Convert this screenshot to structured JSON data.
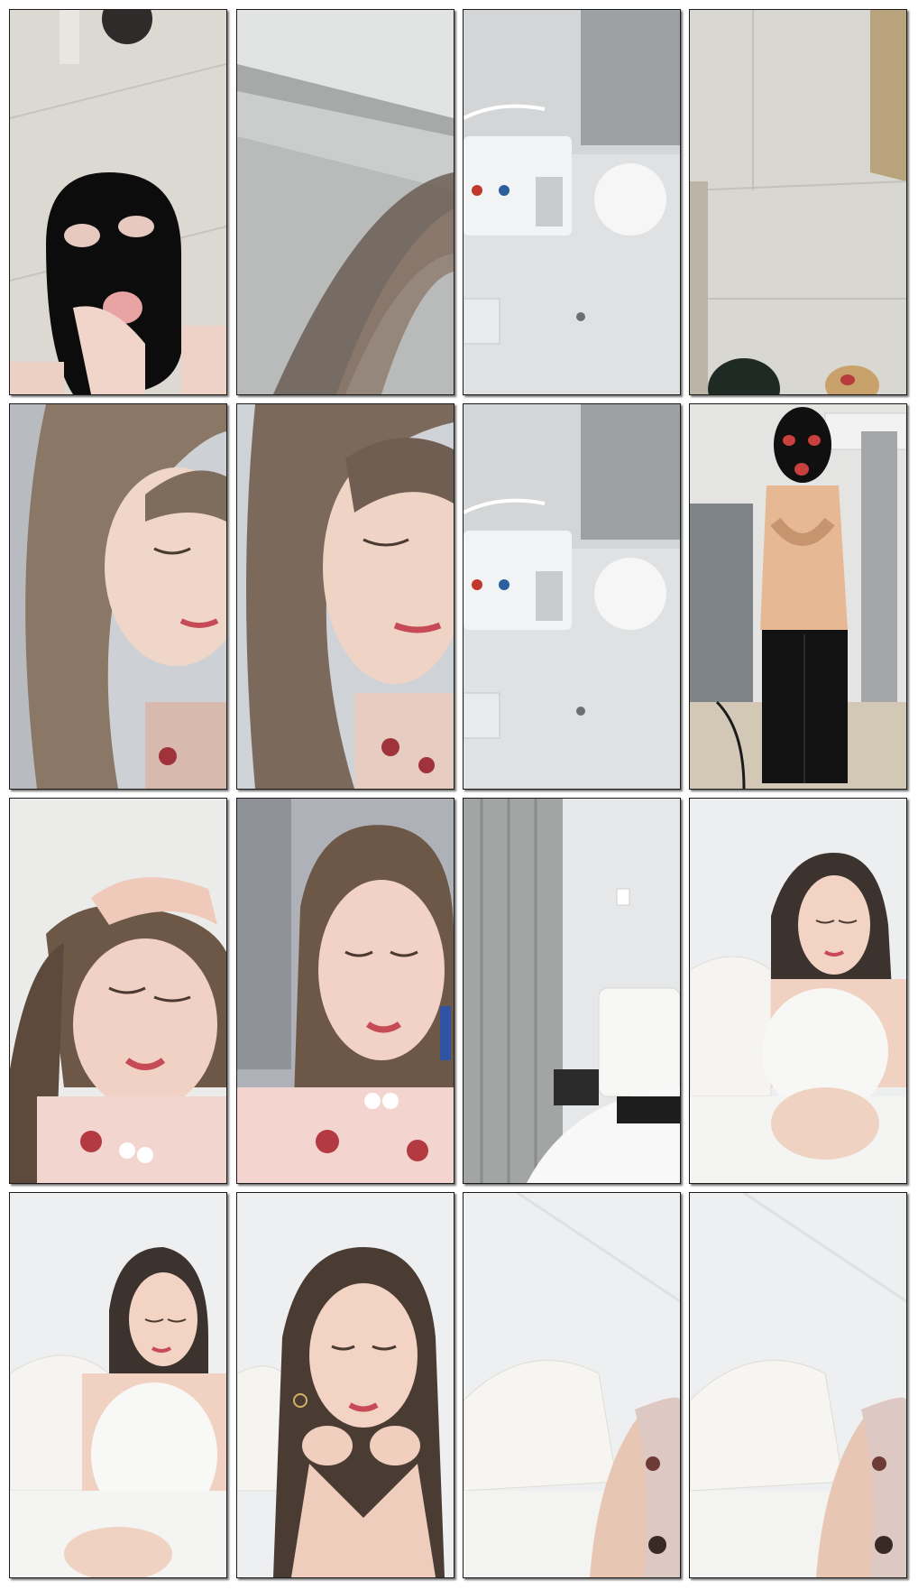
{
  "contact_sheet": {
    "frames": [
      {
        "subject": "black-mask-floor",
        "palette": [
          "#dfdcd6",
          "#0d0d0d",
          "#f0d5cc"
        ]
      },
      {
        "subject": "blurred-ceiling-hair",
        "palette": [
          "#cfd0d0",
          "#6b5e55",
          "#eceeee"
        ]
      },
      {
        "subject": "water-heater",
        "palette": [
          "#d0d2d3",
          "#8d9093",
          "#f3f5f6"
        ]
      },
      {
        "subject": "empty-floor-corner",
        "palette": [
          "#dad8d3",
          "#2a2a2a",
          "#b8a990"
        ]
      },
      {
        "subject": "woman-eyes-closed",
        "palette": [
          "#cfd3d8",
          "#8c7a6a",
          "#f1d9cc"
        ]
      },
      {
        "subject": "woman-eyes-closed-close",
        "palette": [
          "#d2d4d8",
          "#7c6a5c",
          "#f0d6c8"
        ]
      },
      {
        "subject": "water-heater",
        "palette": [
          "#d0d2d3",
          "#8d9093",
          "#f3f5f6"
        ]
      },
      {
        "subject": "masked-man-standing",
        "palette": [
          "#d8d8d6",
          "#111111",
          "#e7b894"
        ]
      },
      {
        "subject": "woman-hand-on-head",
        "palette": [
          "#ebeceb",
          "#6d5848",
          "#f3d2c7"
        ]
      },
      {
        "subject": "woman-looking-camera",
        "palette": [
          "#a9adb3",
          "#6d5848",
          "#f1d0c5"
        ]
      },
      {
        "subject": "bedroom-curtain",
        "palette": [
          "#e5e6e7",
          "#9a9c9c",
          "#f6f6f6"
        ]
      },
      {
        "subject": "woman-sitting-bed",
        "palette": [
          "#eceeef",
          "#3c332e",
          "#f0d2c2"
        ]
      },
      {
        "subject": "woman-sitting-bed-2",
        "palette": [
          "#eeeff0",
          "#3c332e",
          "#f0d2c2"
        ]
      },
      {
        "subject": "woman-chin-on-hands",
        "palette": [
          "#eeeff0",
          "#4b3c33",
          "#f0d2c2"
        ]
      },
      {
        "subject": "bed-headboard-arm",
        "palette": [
          "#eeeff0",
          "#d8d0c8",
          "#e8c6b4"
        ]
      },
      {
        "subject": "bed-headboard-arm",
        "palette": [
          "#eeeff0",
          "#d8d0c8",
          "#e8c6b4"
        ]
      }
    ]
  }
}
